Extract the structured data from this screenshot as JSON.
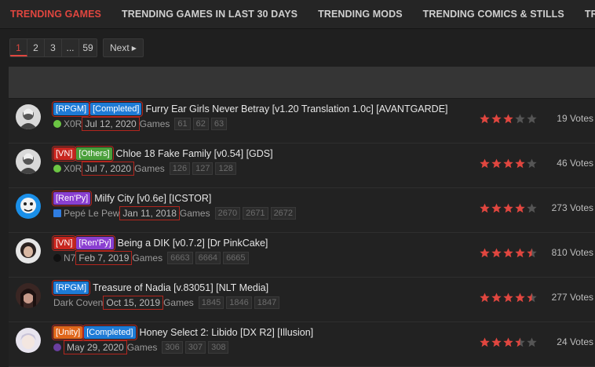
{
  "tabs": [
    "TRENDING GAMES",
    "TRENDING GAMES IN LAST 30 DAYS",
    "TRENDING MODS",
    "TRENDING COMICS & STILLS",
    "TRENDI"
  ],
  "pagination": {
    "pages": [
      "1",
      "2",
      "3",
      "...",
      "59"
    ],
    "next": "Next"
  },
  "colors": {
    "accent": "#e0463f",
    "star_on": "#e0463f",
    "star_off": "#555555"
  },
  "rows": [
    {
      "avatar": "gray-figure-avatar",
      "badges": [
        {
          "text": "[RPGM]",
          "color": "#1e7bd6"
        },
        {
          "text": "[Completed]",
          "color": "#1e7bd6"
        }
      ],
      "title": "Furry Ear Girls Never Betray [v1.20 Translation 1.0c] [AVANTGARDE]",
      "dev_icon": "green-circle-icon",
      "dev_color": "#6cc644",
      "dev": "X0R",
      "date": "Jul 12, 2020",
      "category": "Games",
      "tags": [
        "61",
        "62",
        "63"
      ],
      "stars": 3,
      "half": false,
      "votes": "19 Votes"
    },
    {
      "avatar": "gray-figure-avatar",
      "badges": [
        {
          "text": "[VN]",
          "color": "#c8261f"
        },
        {
          "text": "[Others]",
          "color": "#4a9f3a"
        }
      ],
      "title": "Chloe 18 Fake Family [v0.54] [GDS]",
      "dev_icon": "green-circle-icon",
      "dev_color": "#6cc644",
      "dev": "X0R",
      "date": "Jul 7, 2020",
      "category": "Games",
      "tags": [
        "126",
        "127",
        "128"
      ],
      "stars": 4,
      "half": false,
      "votes": "46 Votes"
    },
    {
      "avatar": "blue-cartoon-avatar",
      "badges": [
        {
          "text": "[Ren'Py]",
          "color": "#8a3fd1"
        }
      ],
      "title": "Milfy City [v0.6e] [ICSTOR]",
      "dev_icon": "blue-square-icon",
      "dev_color": "#2f7de1",
      "dev": "Pepé Le Pew",
      "date": "Jan 11, 2018",
      "category": "Games",
      "tags": [
        "2670",
        "2671",
        "2672"
      ],
      "stars": 4,
      "half": false,
      "votes": "273 Votes"
    },
    {
      "avatar": "woman-portrait-avatar",
      "badges": [
        {
          "text": "[VN]",
          "color": "#c8261f"
        },
        {
          "text": "[Ren'Py]",
          "color": "#8a3fd1"
        }
      ],
      "title": "Being a DIK [v0.7.2] [Dr PinkCake]",
      "dev_icon": "black-circle-icon",
      "dev_color": "#111111",
      "dev": "N7",
      "date": "Feb 7, 2019",
      "category": "Games",
      "tags": [
        "6663",
        "6664",
        "6665"
      ],
      "stars": 4,
      "half": true,
      "votes": "810 Votes"
    },
    {
      "avatar": "dark-hair-avatar",
      "badges": [
        {
          "text": "[RPGM]",
          "color": "#1e7bd6"
        }
      ],
      "title": "Treasure of Nadia [v.83051] [NLT Media]",
      "dev_icon": "",
      "dev_color": "",
      "dev": "Dark Coven",
      "date": "Oct 15, 2019",
      "category": "Games",
      "tags": [
        "1845",
        "1846",
        "1847"
      ],
      "stars": 4,
      "half": true,
      "votes": "277 Votes"
    },
    {
      "avatar": "light-anime-avatar",
      "badges": [
        {
          "text": "[Unity]",
          "color": "#e0661a"
        },
        {
          "text": "[Completed]",
          "color": "#1e7bd6"
        }
      ],
      "title": "Honey Select 2: Libido [DX R2] [Illusion]",
      "dev_icon": "purple-dot-icon",
      "dev_color": "#6a3fa0",
      "dev": "",
      "date": "May 29, 2020",
      "category": "Games",
      "tags": [
        "306",
        "307",
        "308"
      ],
      "stars": 3,
      "half": true,
      "votes": "24 Votes"
    }
  ]
}
